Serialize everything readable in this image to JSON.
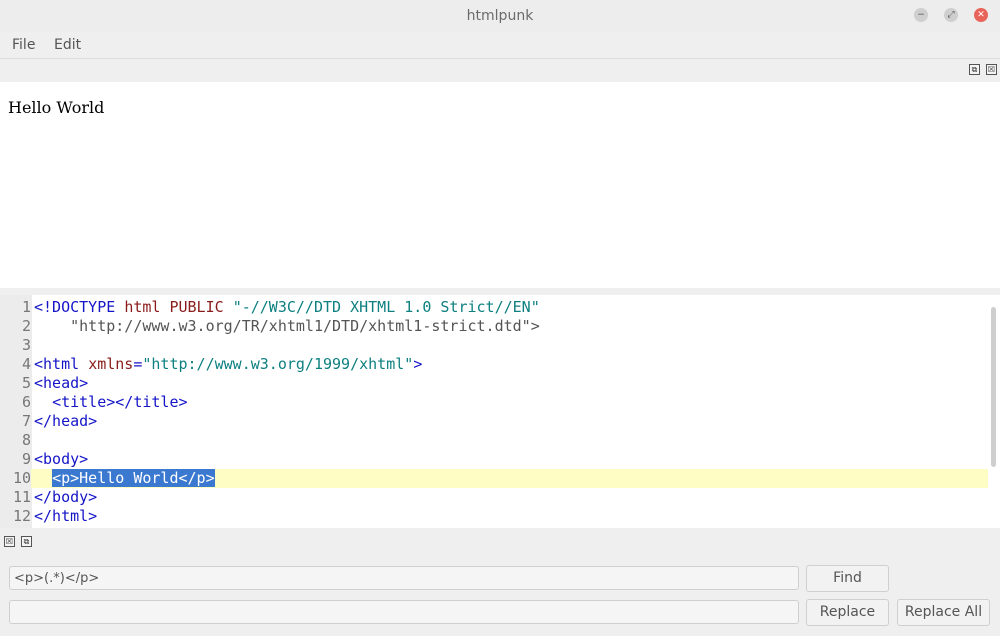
{
  "window": {
    "title": "htmlpunk",
    "minimize_glyph": "−",
    "maximize_glyph": "⤢",
    "close_glyph": "✕"
  },
  "menu": [
    "File",
    "Edit"
  ],
  "dock": {
    "float_glyph": "⧉",
    "close_glyph": "☒"
  },
  "preview": {
    "content": "Hello World"
  },
  "editor": {
    "current_line": 10,
    "lines": [
      {
        "n": "1",
        "parts": [
          [
            "decl",
            "<!DOCTYPE"
          ],
          [
            "sp",
            " "
          ],
          [
            "attr",
            "html"
          ],
          [
            "sp",
            " "
          ],
          [
            "attr",
            "PUBLIC"
          ],
          [
            "sp",
            " "
          ],
          [
            "str",
            "\"-//W3C//DTD XHTML 1.0 Strict//EN\""
          ]
        ]
      },
      {
        "n": "2",
        "parts": [
          [
            "sp",
            "    "
          ],
          [
            "text",
            "\"http://www.w3.org/TR/xhtml1/DTD/xhtml1-strict.dtd\">"
          ]
        ]
      },
      {
        "n": "3",
        "parts": []
      },
      {
        "n": "4",
        "parts": [
          [
            "tag",
            "<html"
          ],
          [
            "sp",
            " "
          ],
          [
            "attr",
            "xmlns"
          ],
          [
            "tag",
            "="
          ],
          [
            "str",
            "\"http://www.w3.org/1999/xhtml\""
          ],
          [
            "tag",
            ">"
          ]
        ]
      },
      {
        "n": "5",
        "parts": [
          [
            "tag",
            "<head>"
          ]
        ]
      },
      {
        "n": "6",
        "parts": [
          [
            "sp",
            "  "
          ],
          [
            "tag",
            "<title></title>"
          ]
        ]
      },
      {
        "n": "7",
        "parts": [
          [
            "tag",
            "</head>"
          ]
        ]
      },
      {
        "n": "8",
        "parts": []
      },
      {
        "n": "9",
        "parts": [
          [
            "tag",
            "<body>"
          ]
        ]
      },
      {
        "n": "10",
        "parts": [
          [
            "sp",
            "  "
          ],
          [
            "sel",
            "<p>Hello World</p>"
          ]
        ]
      },
      {
        "n": "11",
        "parts": [
          [
            "tag",
            "</body>"
          ]
        ]
      },
      {
        "n": "12",
        "parts": [
          [
            "tag",
            "</html>"
          ]
        ]
      }
    ]
  },
  "find_panel": {
    "find_value": "<p>(.*)</p>",
    "replace_value": "",
    "find_label": "Find",
    "replace_label": "Replace",
    "replace_all_label": "Replace All"
  },
  "colors": {
    "tag": "#1515c8",
    "attr": "#8a1b1b",
    "string": "#0e8080",
    "selection": "#3b78d0",
    "current_line": "#fefdc4"
  }
}
